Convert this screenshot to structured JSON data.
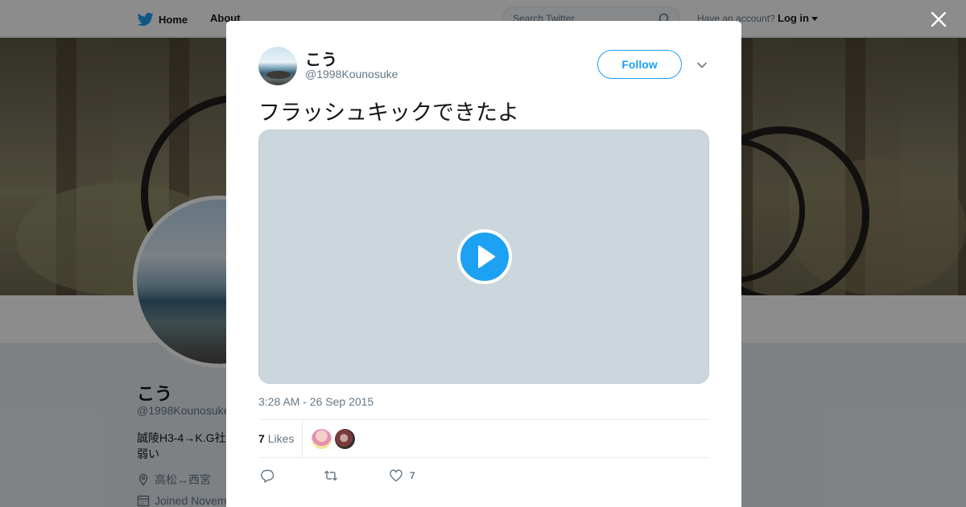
{
  "page": {
    "nav": {
      "home": "Home",
      "about": "About"
    },
    "search": {
      "placeholder": "Search Twitter"
    },
    "account": {
      "prompt": "Have an account?",
      "login": "Log in"
    },
    "colors": {
      "brand": "#1da1f2",
      "text": "#14171a",
      "secondary": "#657786",
      "overlay": "rgba(0,0,0,0.45)"
    }
  },
  "profile": {
    "name": "こう",
    "handle": "@1998Kounosuke",
    "bio": "誠陵H3-4→K.G社 弱い",
    "location": "高松↔西宮",
    "joined": "Joined Novem"
  },
  "tweet": {
    "author_name": "こう",
    "author_handle": "@1998Kounosuke",
    "follow_label": "Follow",
    "text": "フラッシュキックできたよ",
    "timestamp": "3:28 AM - 26 Sep 2015",
    "likes_count": "7",
    "likes_label": "Likes",
    "action_like_count": "7"
  },
  "icons": [
    "twitter-bird-icon",
    "search-icon",
    "close-icon",
    "chevron-down-icon",
    "play-icon",
    "reply-icon",
    "retweet-icon",
    "heart-icon",
    "location-icon",
    "calendar-icon"
  ]
}
